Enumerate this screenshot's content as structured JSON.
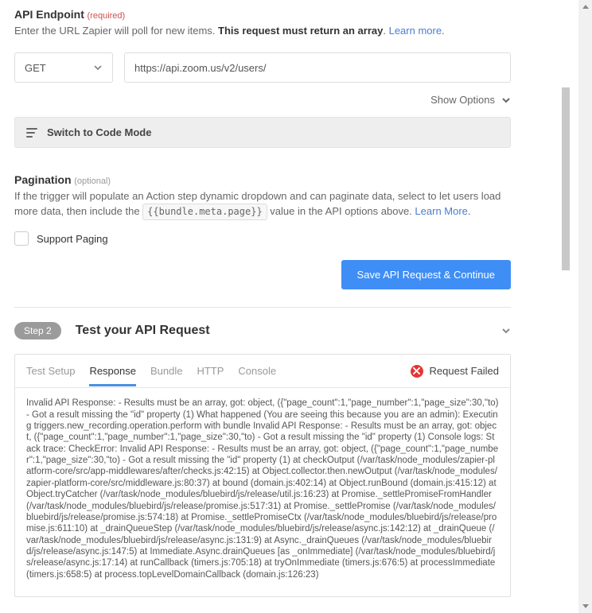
{
  "api_endpoint": {
    "title": "API Endpoint",
    "required_label": "(required)",
    "help_prefix": "Enter the URL Zapier will poll for new items. ",
    "help_bold": "This request must return an array",
    "help_suffix": ". ",
    "learn_more": "Learn more",
    "method": "GET",
    "url": "https://api.zoom.us/v2/users/",
    "show_options": "Show Options",
    "code_mode": "Switch to Code Mode"
  },
  "pagination": {
    "title": "Pagination",
    "optional_label": "(optional)",
    "help_prefix": "If the trigger will populate an Action step dynamic dropdown and can paginate data, select to let users load more data, then include the ",
    "code_chip": "{{bundle.meta.page}}",
    "help_suffix": " value in the API options above. ",
    "learn_more": "Learn More",
    "checkbox_label": "Support Paging"
  },
  "save_button": "Save API Request & Continue",
  "step2": {
    "badge": "Step 2",
    "title": "Test your API Request"
  },
  "tabs": {
    "test_setup": "Test Setup",
    "response": "Response",
    "bundle": "Bundle",
    "http": "HTTP",
    "console": "Console"
  },
  "status": {
    "label": "Request Failed"
  },
  "error_text": "Invalid API Response: - Results must be an array, got: object, ({\"page_count\":1,\"page_number\":1,\"page_size\":30,\"to) - Got a result missing the \"id\" property (1) What happened (You are seeing this because you are an admin): Executing triggers.new_recording.operation.perform with bundle Invalid API Response: - Results must be an array, got: object, ({\"page_count\":1,\"page_number\":1,\"page_size\":30,\"to) - Got a result missing the \"id\" property (1) Console logs: Stack trace: CheckError: Invalid API Response: - Results must be an array, got: object, ({\"page_count\":1,\"page_number\":1,\"page_size\":30,\"to) - Got a result missing the \"id\" property (1) at checkOutput (/var/task/node_modules/zapier-platform-core/src/app-middlewares/after/checks.js:42:15) at Object.collector.then.newOutput (/var/task/node_modules/zapier-platform-core/src/middleware.js:80:37) at bound (domain.js:402:14) at Object.runBound (domain.js:415:12) at Object.tryCatcher (/var/task/node_modules/bluebird/js/release/util.js:16:23) at Promise._settlePromiseFromHandler (/var/task/node_modules/bluebird/js/release/promise.js:517:31) at Promise._settlePromise (/var/task/node_modules/bluebird/js/release/promise.js:574:18) at Promise._settlePromiseCtx (/var/task/node_modules/bluebird/js/release/promise.js:611:10) at _drainQueueStep (/var/task/node_modules/bluebird/js/release/async.js:142:12) at _drainQueue (/var/task/node_modules/bluebird/js/release/async.js:131:9) at Async._drainQueues (/var/task/node_modules/bluebird/js/release/async.js:147:5) at Immediate.Async.drainQueues [as _onImmediate] (/var/task/node_modules/bluebird/js/release/async.js:17:14) at runCallback (timers.js:705:18) at tryOnImmediate (timers.js:676:5) at processImmediate (timers.js:658:5) at process.topLevelDomainCallback (domain.js:126:23)"
}
